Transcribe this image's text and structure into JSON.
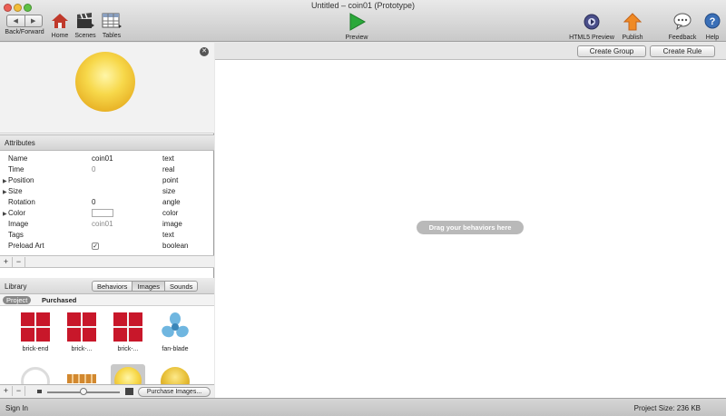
{
  "window": {
    "title": "Untitled – coin01 (Prototype)",
    "controls": {
      "close_color": "#ec5f56",
      "minimize_color": "#f2bd3a",
      "zoom_color": "#5fc145"
    }
  },
  "toolbar": {
    "back_forward": "Back/Forward",
    "home": "Home",
    "scenes": "Scenes",
    "tables": "Tables",
    "preview": "Preview",
    "html5_preview": "HTML5 Preview",
    "publish": "Publish",
    "feedback": "Feedback",
    "help": "Help"
  },
  "attributes": {
    "header": "Attributes",
    "rows": [
      {
        "name": "Name",
        "value": "coin01",
        "type": "text"
      },
      {
        "name": "Time",
        "value": "0",
        "type": "real"
      },
      {
        "name": "Position",
        "value": "",
        "type": "point"
      },
      {
        "name": "Size",
        "value": "",
        "type": "size"
      },
      {
        "name": "Rotation",
        "value": "0",
        "type": "angle"
      },
      {
        "name": "Color",
        "value": "",
        "type": "color"
      },
      {
        "name": "Image",
        "value": "coin01",
        "type": "image"
      },
      {
        "name": "Tags",
        "value": "",
        "type": "text"
      },
      {
        "name": "Preload Art",
        "value": "",
        "type": "boolean"
      }
    ]
  },
  "library": {
    "title": "Library",
    "tabs": [
      "Behaviors",
      "Images",
      "Sounds"
    ],
    "subtabs": [
      "Project",
      "Purchased"
    ],
    "items": [
      {
        "label": "brick-end",
        "icon": "brick-icon"
      },
      {
        "label": "brick-...",
        "icon": "brick-icon"
      },
      {
        "label": "brick-...",
        "icon": "brick-icon"
      },
      {
        "label": "fan-blade",
        "icon": "fan-blade-icon"
      }
    ],
    "purchase_button": "Purchase Images...",
    "zoom_level": 0.5
  },
  "rules": {
    "create_group": "Create Group",
    "create_rule": "Create Rule",
    "drop_hint": "Drag your behaviors here"
  },
  "status": {
    "sign_in": "Sign In",
    "project_size": "Project Size: 236 KB"
  }
}
